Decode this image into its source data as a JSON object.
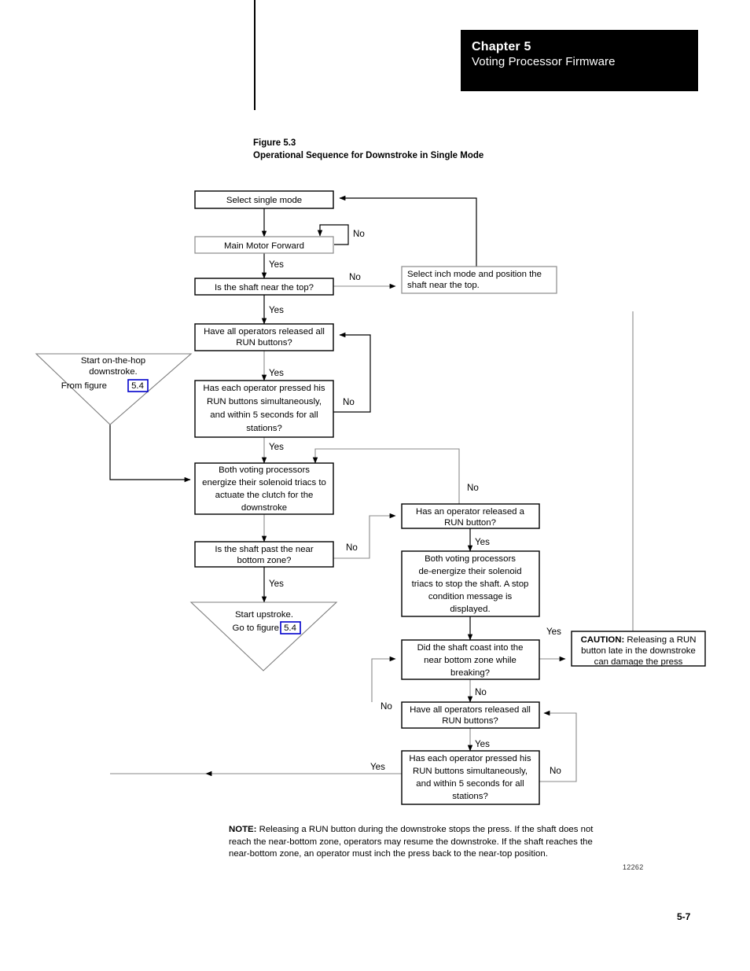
{
  "header": {
    "chapter_label": "Chapter 5",
    "chapter_subtitle": "Voting Processor Firmware"
  },
  "figure": {
    "number_line": "Figure 5.3",
    "title_line": "Operational Sequence for Downstroke in Single Mode",
    "figure_id": "12262"
  },
  "page": {
    "number": "5-7"
  },
  "note": {
    "label": "NOTE:",
    "text": " Releasing a RUN button during the downstroke stops the press. If the shaft does not reach the near-bottom zone, operators may resume the downstroke.  If the shaft reaches the near-bottom zone, an operator must inch the press back to the near-top position."
  },
  "caution": {
    "label": "CAUTION:",
    "line1_rest": " Releasing a RUN",
    "line2": "button late in the downstroke",
    "line3": "can damage the press"
  },
  "flowchart": {
    "type": "flowchart",
    "nodes": [
      {
        "id": "select-single-mode",
        "lines": [
          "Select single mode"
        ]
      },
      {
        "id": "main-motor-forward",
        "lines": [
          "Main Motor Forward"
        ]
      },
      {
        "id": "shaft-near-top",
        "lines": [
          "Is the shaft near the top?"
        ]
      },
      {
        "id": "select-inch-mode",
        "lines": [
          "Select inch mode and position the",
          "shaft near the top."
        ]
      },
      {
        "id": "operators-released-all-run-1",
        "lines": [
          "Have all operators released all",
          "RUN buttons?"
        ]
      },
      {
        "id": "each-operator-pressed-1",
        "lines": [
          "Has each operator pressed his",
          "RUN buttons simultaneously,",
          "and within 5 seconds for all",
          "stations?"
        ]
      },
      {
        "id": "energize-solenoid-triacs",
        "lines": [
          "Both voting processors",
          "energize their solenoid triacs to",
          "actuate the clutch for the",
          "downstroke"
        ]
      },
      {
        "id": "shaft-past-near-bottom",
        "lines": [
          "Is the shaft past the near",
          "bottom zone?"
        ]
      },
      {
        "id": "operator-released-run",
        "lines": [
          "Has an operator released a",
          "RUN button?"
        ]
      },
      {
        "id": "de-energize-solenoid-triacs",
        "lines": [
          "Both voting processors",
          "de-energize their solenoid",
          "triacs to stop the shaft. A stop",
          "condition message is",
          "displayed."
        ]
      },
      {
        "id": "shaft-coast-near-bottom",
        "lines": [
          "Did the shaft coast into the",
          "near bottom zone while",
          "breaking?"
        ]
      },
      {
        "id": "operators-released-all-run-2",
        "lines": [
          "Have all operators released all",
          "RUN buttons?"
        ]
      },
      {
        "id": "each-operator-pressed-2",
        "lines": [
          "Has each operator pressed his",
          "RUN buttons simultaneously,",
          "and within 5 seconds for all",
          "stations?"
        ]
      }
    ],
    "connectors": [
      {
        "id": "start-on-the-hop",
        "lines": [
          "Start on-the-hop",
          "downstroke.",
          "From figure"
        ],
        "link_label": "5.4"
      },
      {
        "id": "start-upstroke",
        "lines": [
          "Start upstroke.",
          "Go to figure"
        ],
        "link_label": "5.4"
      }
    ],
    "edge_labels": {
      "no": "No",
      "yes": "Yes"
    },
    "edges": [
      {
        "from": "select-single-mode",
        "to": "main-motor-forward",
        "label": ""
      },
      {
        "from": "main-motor-forward",
        "to": "main-motor-forward",
        "label": "No"
      },
      {
        "from": "main-motor-forward",
        "to": "shaft-near-top",
        "label": "Yes"
      },
      {
        "from": "shaft-near-top",
        "to": "select-inch-mode",
        "label": "No"
      },
      {
        "from": "select-inch-mode",
        "to": "select-single-mode",
        "label": ""
      },
      {
        "from": "shaft-near-top",
        "to": "operators-released-all-run-1",
        "label": "Yes"
      },
      {
        "from": "operators-released-all-run-1",
        "to": "each-operator-pressed-1",
        "label": "Yes"
      },
      {
        "from": "each-operator-pressed-1",
        "to": "operators-released-all-run-1",
        "label": "No"
      },
      {
        "from": "each-operator-pressed-1",
        "to": "energize-solenoid-triacs",
        "label": "Yes"
      },
      {
        "from": "start-on-the-hop",
        "to": "energize-solenoid-triacs",
        "label": ""
      },
      {
        "from": "energize-solenoid-triacs",
        "to": "shaft-past-near-bottom",
        "label": ""
      },
      {
        "from": "shaft-past-near-bottom",
        "to": "operator-released-run",
        "label": "No"
      },
      {
        "from": "shaft-past-near-bottom",
        "to": "start-upstroke",
        "label": "Yes"
      },
      {
        "from": "operator-released-run",
        "to": "energize-solenoid-triacs",
        "label": "No"
      },
      {
        "from": "operator-released-run",
        "to": "de-energize-solenoid-triacs",
        "label": "Yes"
      },
      {
        "from": "de-energize-solenoid-triacs",
        "to": "shaft-coast-near-bottom",
        "label": ""
      },
      {
        "from": "shaft-coast-near-bottom",
        "to": "caution",
        "label": "Yes"
      },
      {
        "from": "shaft-coast-near-bottom",
        "to": "operators-released-all-run-2",
        "label": "No"
      },
      {
        "from": "operators-released-all-run-2",
        "to": "each-operator-pressed-2",
        "label": "Yes"
      },
      {
        "from": "each-operator-pressed-2",
        "to": "operators-released-all-run-2",
        "label": "No"
      },
      {
        "from": "each-operator-pressed-2",
        "to": "energize-solenoid-triacs",
        "label": "Yes"
      },
      {
        "from": "shaft-coast-near-bottom",
        "to": "shaft-coast-near-bottom",
        "label": "No"
      },
      {
        "from": "caution",
        "to": "select-inch-mode",
        "label": ""
      }
    ]
  }
}
